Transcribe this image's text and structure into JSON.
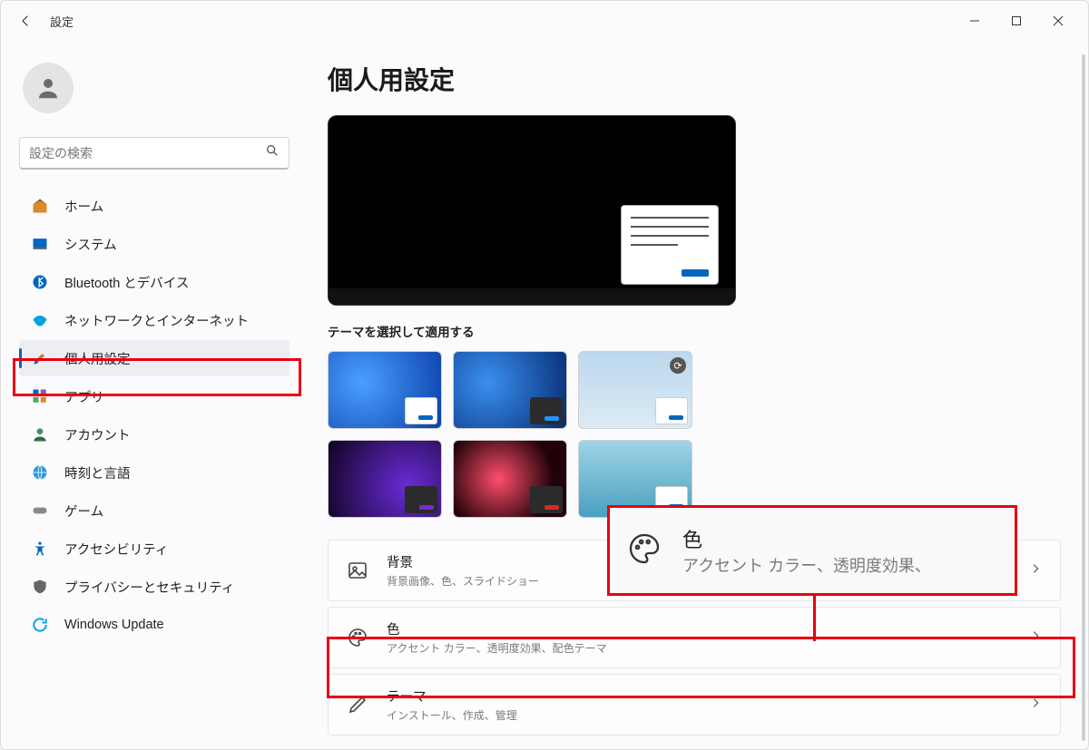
{
  "window": {
    "title": "設定"
  },
  "search": {
    "placeholder": "設定の検索"
  },
  "sidebar": {
    "items": [
      {
        "label": "ホーム"
      },
      {
        "label": "システム"
      },
      {
        "label": "Bluetooth とデバイス"
      },
      {
        "label": "ネットワークとインターネット"
      },
      {
        "label": "個人用設定"
      },
      {
        "label": "アプリ"
      },
      {
        "label": "アカウント"
      },
      {
        "label": "時刻と言語"
      },
      {
        "label": "ゲーム"
      },
      {
        "label": "アクセシビリティ"
      },
      {
        "label": "プライバシーとセキュリティ"
      },
      {
        "label": "Windows Update"
      }
    ]
  },
  "page": {
    "title": "個人用設定",
    "theme_section": "テーマを選択して適用する"
  },
  "cards": {
    "background": {
      "title": "背景",
      "subtitle": "背景画像、色、スライドショー"
    },
    "colors": {
      "title": "色",
      "subtitle": "アクセント カラー、透明度効果、配色テーマ"
    },
    "themes": {
      "title": "テーマ",
      "subtitle": "インストール、作成、管理"
    }
  },
  "callout": {
    "title": "色",
    "subtitle": "アクセント カラー、透明度効果、"
  }
}
